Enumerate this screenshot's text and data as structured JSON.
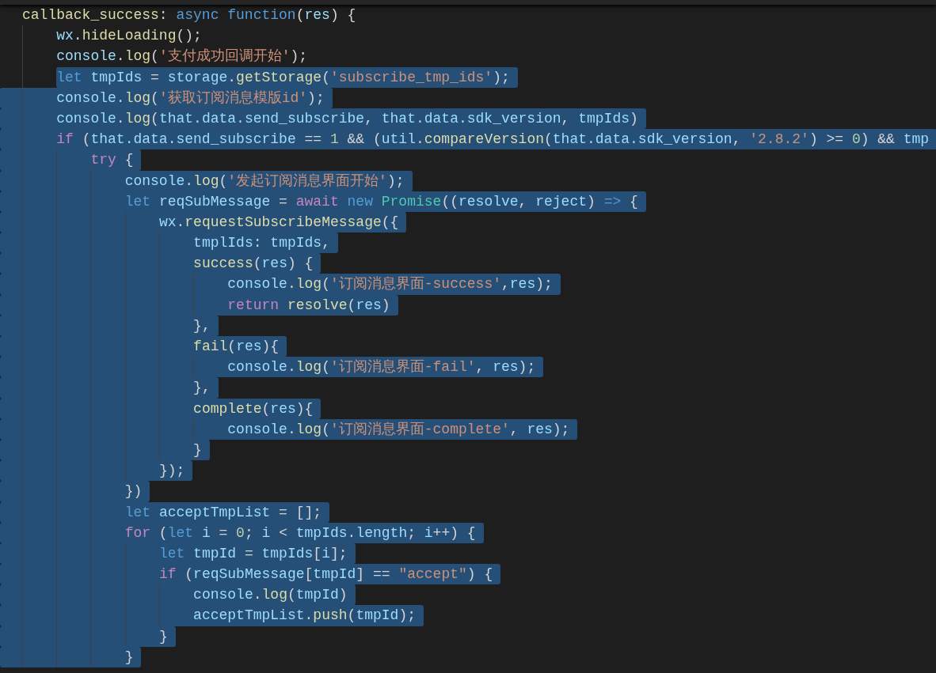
{
  "editor": {
    "lines": [
      {
        "selected": false,
        "tokens": [
          {
            "kind": "fn",
            "text": "callback_success"
          },
          {
            "kind": "txt",
            "text": ": "
          },
          {
            "kind": "kw",
            "text": "async "
          },
          {
            "kind": "kw",
            "text": "function"
          },
          {
            "kind": "txt",
            "text": "("
          },
          {
            "kind": "var",
            "text": "res"
          },
          {
            "kind": "txt",
            "text": ") {"
          }
        ]
      },
      {
        "selected": false,
        "tokens": [
          {
            "kind": "var",
            "text": "    wx"
          },
          {
            "kind": "txt",
            "text": "."
          },
          {
            "kind": "fn",
            "text": "hideLoading"
          },
          {
            "kind": "txt",
            "text": "();"
          }
        ]
      },
      {
        "selected": false,
        "tokens": [
          {
            "kind": "var",
            "text": "    console"
          },
          {
            "kind": "txt",
            "text": "."
          },
          {
            "kind": "fn",
            "text": "log"
          },
          {
            "kind": "txt",
            "text": "("
          },
          {
            "kind": "str",
            "text": "'支付成功回调开始'"
          },
          {
            "kind": "txt",
            "text": ");"
          }
        ]
      },
      {
        "selected": true,
        "tokens": [
          {
            "kind": "kw",
            "text": "    let "
          },
          {
            "kind": "var",
            "text": "tmpIds"
          },
          {
            "kind": "txt",
            "text": " = "
          },
          {
            "kind": "var",
            "text": "storage"
          },
          {
            "kind": "txt",
            "text": "."
          },
          {
            "kind": "fn",
            "text": "getStorage"
          },
          {
            "kind": "txt",
            "text": "("
          },
          {
            "kind": "str",
            "text": "'subscribe_tmp_ids'"
          },
          {
            "kind": "txt",
            "text": ");"
          }
        ]
      },
      {
        "selected": true,
        "tokens": [
          {
            "kind": "var",
            "text": "    console"
          },
          {
            "kind": "txt",
            "text": "."
          },
          {
            "kind": "fn",
            "text": "log"
          },
          {
            "kind": "txt",
            "text": "("
          },
          {
            "kind": "str",
            "text": "'获取订阅消息模版id'"
          },
          {
            "kind": "txt",
            "text": ");"
          }
        ]
      },
      {
        "selected": true,
        "tokens": [
          {
            "kind": "var",
            "text": "    console"
          },
          {
            "kind": "txt",
            "text": "."
          },
          {
            "kind": "fn",
            "text": "log"
          },
          {
            "kind": "txt",
            "text": "("
          },
          {
            "kind": "var",
            "text": "that.data.send_subscribe"
          },
          {
            "kind": "txt",
            "text": ", "
          },
          {
            "kind": "var",
            "text": "that.data.sdk_version"
          },
          {
            "kind": "txt",
            "text": ", "
          },
          {
            "kind": "var",
            "text": "tmpIds"
          },
          {
            "kind": "txt",
            "text": ")"
          }
        ]
      },
      {
        "selected": true,
        "tokens": [
          {
            "kind": "ctl",
            "text": "    if"
          },
          {
            "kind": "txt",
            "text": " ("
          },
          {
            "kind": "var",
            "text": "that.data.send_subscribe"
          },
          {
            "kind": "txt",
            "text": " == "
          },
          {
            "kind": "num",
            "text": "1"
          },
          {
            "kind": "txt",
            "text": " && ("
          },
          {
            "kind": "var",
            "text": "util"
          },
          {
            "kind": "txt",
            "text": "."
          },
          {
            "kind": "fn",
            "text": "compareVersion"
          },
          {
            "kind": "txt",
            "text": "("
          },
          {
            "kind": "var",
            "text": "that.data.sdk_version"
          },
          {
            "kind": "txt",
            "text": ", "
          },
          {
            "kind": "str",
            "text": "'2.8.2'"
          },
          {
            "kind": "txt",
            "text": ") >= "
          },
          {
            "kind": "num",
            "text": "0"
          },
          {
            "kind": "txt",
            "text": ") && "
          },
          {
            "kind": "var",
            "text": "tmp"
          }
        ]
      },
      {
        "selected": true,
        "tokens": [
          {
            "kind": "ctl",
            "text": "        try"
          },
          {
            "kind": "txt",
            "text": " {"
          }
        ]
      },
      {
        "selected": true,
        "tokens": [
          {
            "kind": "var",
            "text": "            console"
          },
          {
            "kind": "txt",
            "text": "."
          },
          {
            "kind": "fn",
            "text": "log"
          },
          {
            "kind": "txt",
            "text": "("
          },
          {
            "kind": "str",
            "text": "'发起订阅消息界面开始'"
          },
          {
            "kind": "txt",
            "text": ");"
          }
        ]
      },
      {
        "selected": true,
        "tokens": [
          {
            "kind": "kw",
            "text": "            let "
          },
          {
            "kind": "var",
            "text": "reqSubMessage"
          },
          {
            "kind": "txt",
            "text": " = "
          },
          {
            "kind": "ctl",
            "text": "await "
          },
          {
            "kind": "kw",
            "text": "new "
          },
          {
            "kind": "cls",
            "text": "Promise"
          },
          {
            "kind": "txt",
            "text": "(("
          },
          {
            "kind": "var",
            "text": "resolve"
          },
          {
            "kind": "txt",
            "text": ", "
          },
          {
            "kind": "var",
            "text": "reject"
          },
          {
            "kind": "txt",
            "text": ") "
          },
          {
            "kind": "kw",
            "text": "=>"
          },
          {
            "kind": "txt",
            "text": " {"
          }
        ]
      },
      {
        "selected": true,
        "tokens": [
          {
            "kind": "var",
            "text": "                wx"
          },
          {
            "kind": "txt",
            "text": "."
          },
          {
            "kind": "fn",
            "text": "requestSubscribeMessage"
          },
          {
            "kind": "txt",
            "text": "({"
          }
        ]
      },
      {
        "selected": true,
        "tokens": [
          {
            "kind": "var",
            "text": "                    tmplIds"
          },
          {
            "kind": "txt",
            "text": ": "
          },
          {
            "kind": "var",
            "text": "tmpIds"
          },
          {
            "kind": "txt",
            "text": ","
          }
        ]
      },
      {
        "selected": true,
        "tokens": [
          {
            "kind": "fn",
            "text": "                    success"
          },
          {
            "kind": "txt",
            "text": "("
          },
          {
            "kind": "var",
            "text": "res"
          },
          {
            "kind": "txt",
            "text": ") {"
          }
        ]
      },
      {
        "selected": true,
        "tokens": [
          {
            "kind": "var",
            "text": "                        console"
          },
          {
            "kind": "txt",
            "text": "."
          },
          {
            "kind": "fn",
            "text": "log"
          },
          {
            "kind": "txt",
            "text": "("
          },
          {
            "kind": "str",
            "text": "'订阅消息界面-success'"
          },
          {
            "kind": "txt",
            "text": ","
          },
          {
            "kind": "var",
            "text": "res"
          },
          {
            "kind": "txt",
            "text": ");"
          }
        ]
      },
      {
        "selected": true,
        "tokens": [
          {
            "kind": "ctl",
            "text": "                        return "
          },
          {
            "kind": "fn",
            "text": "resolve"
          },
          {
            "kind": "txt",
            "text": "("
          },
          {
            "kind": "var",
            "text": "res"
          },
          {
            "kind": "txt",
            "text": ")"
          }
        ]
      },
      {
        "selected": true,
        "tokens": [
          {
            "kind": "txt",
            "text": "                    },"
          }
        ]
      },
      {
        "selected": true,
        "tokens": [
          {
            "kind": "fn",
            "text": "                    fail"
          },
          {
            "kind": "txt",
            "text": "("
          },
          {
            "kind": "var",
            "text": "res"
          },
          {
            "kind": "txt",
            "text": "){"
          }
        ]
      },
      {
        "selected": true,
        "tokens": [
          {
            "kind": "var",
            "text": "                        console"
          },
          {
            "kind": "txt",
            "text": "."
          },
          {
            "kind": "fn",
            "text": "log"
          },
          {
            "kind": "txt",
            "text": "("
          },
          {
            "kind": "str",
            "text": "'订阅消息界面-fail'"
          },
          {
            "kind": "txt",
            "text": ", "
          },
          {
            "kind": "var",
            "text": "res"
          },
          {
            "kind": "txt",
            "text": ");"
          }
        ]
      },
      {
        "selected": true,
        "tokens": [
          {
            "kind": "txt",
            "text": "                    },"
          }
        ]
      },
      {
        "selected": true,
        "tokens": [
          {
            "kind": "fn",
            "text": "                    complete"
          },
          {
            "kind": "txt",
            "text": "("
          },
          {
            "kind": "var",
            "text": "res"
          },
          {
            "kind": "txt",
            "text": "){"
          }
        ]
      },
      {
        "selected": true,
        "tokens": [
          {
            "kind": "var",
            "text": "                        console"
          },
          {
            "kind": "txt",
            "text": "."
          },
          {
            "kind": "fn",
            "text": "log"
          },
          {
            "kind": "txt",
            "text": "("
          },
          {
            "kind": "str",
            "text": "'订阅消息界面-complete'"
          },
          {
            "kind": "txt",
            "text": ", "
          },
          {
            "kind": "var",
            "text": "res"
          },
          {
            "kind": "txt",
            "text": ");"
          }
        ]
      },
      {
        "selected": true,
        "tokens": [
          {
            "kind": "txt",
            "text": "                    }"
          }
        ]
      },
      {
        "selected": true,
        "tokens": [
          {
            "kind": "txt",
            "text": "                });"
          }
        ]
      },
      {
        "selected": true,
        "tokens": [
          {
            "kind": "txt",
            "text": "            })"
          }
        ]
      },
      {
        "selected": true,
        "tokens": [
          {
            "kind": "kw",
            "text": "            let "
          },
          {
            "kind": "var",
            "text": "acceptTmpList"
          },
          {
            "kind": "txt",
            "text": " = [];"
          }
        ]
      },
      {
        "selected": true,
        "tokens": [
          {
            "kind": "ctl",
            "text": "            for"
          },
          {
            "kind": "txt",
            "text": " ("
          },
          {
            "kind": "kw",
            "text": "let "
          },
          {
            "kind": "var",
            "text": "i"
          },
          {
            "kind": "txt",
            "text": " = "
          },
          {
            "kind": "num",
            "text": "0"
          },
          {
            "kind": "txt",
            "text": "; "
          },
          {
            "kind": "var",
            "text": "i"
          },
          {
            "kind": "txt",
            "text": " < "
          },
          {
            "kind": "var",
            "text": "tmpIds"
          },
          {
            "kind": "txt",
            "text": "."
          },
          {
            "kind": "var",
            "text": "length"
          },
          {
            "kind": "txt",
            "text": "; "
          },
          {
            "kind": "var",
            "text": "i"
          },
          {
            "kind": "txt",
            "text": "++) {"
          }
        ]
      },
      {
        "selected": true,
        "tokens": [
          {
            "kind": "kw",
            "text": "                let "
          },
          {
            "kind": "var",
            "text": "tmpId"
          },
          {
            "kind": "txt",
            "text": " = "
          },
          {
            "kind": "var",
            "text": "tmpIds"
          },
          {
            "kind": "txt",
            "text": "["
          },
          {
            "kind": "var",
            "text": "i"
          },
          {
            "kind": "txt",
            "text": "];"
          }
        ]
      },
      {
        "selected": true,
        "tokens": [
          {
            "kind": "ctl",
            "text": "                if"
          },
          {
            "kind": "txt",
            "text": " ("
          },
          {
            "kind": "var",
            "text": "reqSubMessage"
          },
          {
            "kind": "txt",
            "text": "["
          },
          {
            "kind": "var",
            "text": "tmpId"
          },
          {
            "kind": "txt",
            "text": "] == "
          },
          {
            "kind": "str",
            "text": "\"accept\""
          },
          {
            "kind": "txt",
            "text": ") {"
          }
        ]
      },
      {
        "selected": true,
        "tokens": [
          {
            "kind": "var",
            "text": "                    console"
          },
          {
            "kind": "txt",
            "text": "."
          },
          {
            "kind": "fn",
            "text": "log"
          },
          {
            "kind": "txt",
            "text": "("
          },
          {
            "kind": "var",
            "text": "tmpId"
          },
          {
            "kind": "txt",
            "text": ")"
          }
        ]
      },
      {
        "selected": true,
        "tokens": [
          {
            "kind": "var",
            "text": "                    acceptTmpList"
          },
          {
            "kind": "txt",
            "text": "."
          },
          {
            "kind": "fn",
            "text": "push"
          },
          {
            "kind": "txt",
            "text": "("
          },
          {
            "kind": "var",
            "text": "tmpId"
          },
          {
            "kind": "txt",
            "text": ");"
          }
        ]
      },
      {
        "selected": true,
        "tokens": [
          {
            "kind": "txt",
            "text": "                }"
          }
        ]
      },
      {
        "selected": true,
        "tokens": [
          {
            "kind": "txt",
            "text": "            }"
          }
        ]
      }
    ]
  }
}
